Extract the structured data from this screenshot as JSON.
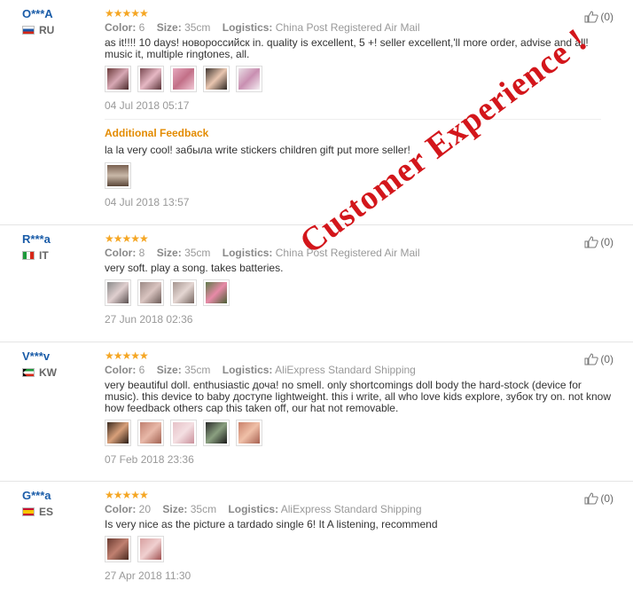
{
  "labels": {
    "color": "Color:",
    "size": "Size:",
    "logistics": "Logistics:"
  },
  "reviews": [
    {
      "user": "O***A",
      "country": "RU",
      "stars": "★★★★★",
      "color": "6",
      "size": "35cm",
      "logistics": "China Post Registered Air Mail",
      "text": "as it!!!! 10 days! новороссийск in. quality is excellent, 5 +! seller excellent,'ll more order, advise and all! music it, multiple ringtones, all.",
      "date": "04 Jul 2018 05:17",
      "helpful": "(0)",
      "additional_title": "Additional Feedback",
      "additional_text": "la la very cool! забыла write stickers children gift put more seller!",
      "additional_date": "04 Jul 2018 13:57"
    },
    {
      "user": "R***a",
      "country": "IT",
      "stars": "★★★★★",
      "color": "8",
      "size": "35cm",
      "logistics": "China Post Registered Air Mail",
      "text": "very soft. play a song. takes batteries.",
      "date": "27 Jun 2018 02:36",
      "helpful": "(0)"
    },
    {
      "user": "V***v",
      "country": "KW",
      "stars": "★★★★★",
      "color": "6",
      "size": "35cm",
      "logistics": "AliExpress Standard Shipping",
      "text": "very beautiful doll. enthusiastic доча! no smell. only shortcomings doll body the hard-stock (device for music). this device to baby доступе lightweight. this i write, all who love kids explore, зубок try on. not know how feedback others cap this taken off, our hat not removable.",
      "date": "07 Feb 2018 23:36",
      "helpful": "(0)"
    },
    {
      "user": "G***a",
      "country": "ES",
      "stars": "★★★★★",
      "color": "20",
      "size": "35cm",
      "logistics": "AliExpress Standard Shipping",
      "text": "Is very nice as the picture a tardado single 6! It A listening, recommend",
      "date": "27 Apr 2018 11:30",
      "helpful": "(0)"
    }
  ],
  "watermark": "Customer Experience !"
}
